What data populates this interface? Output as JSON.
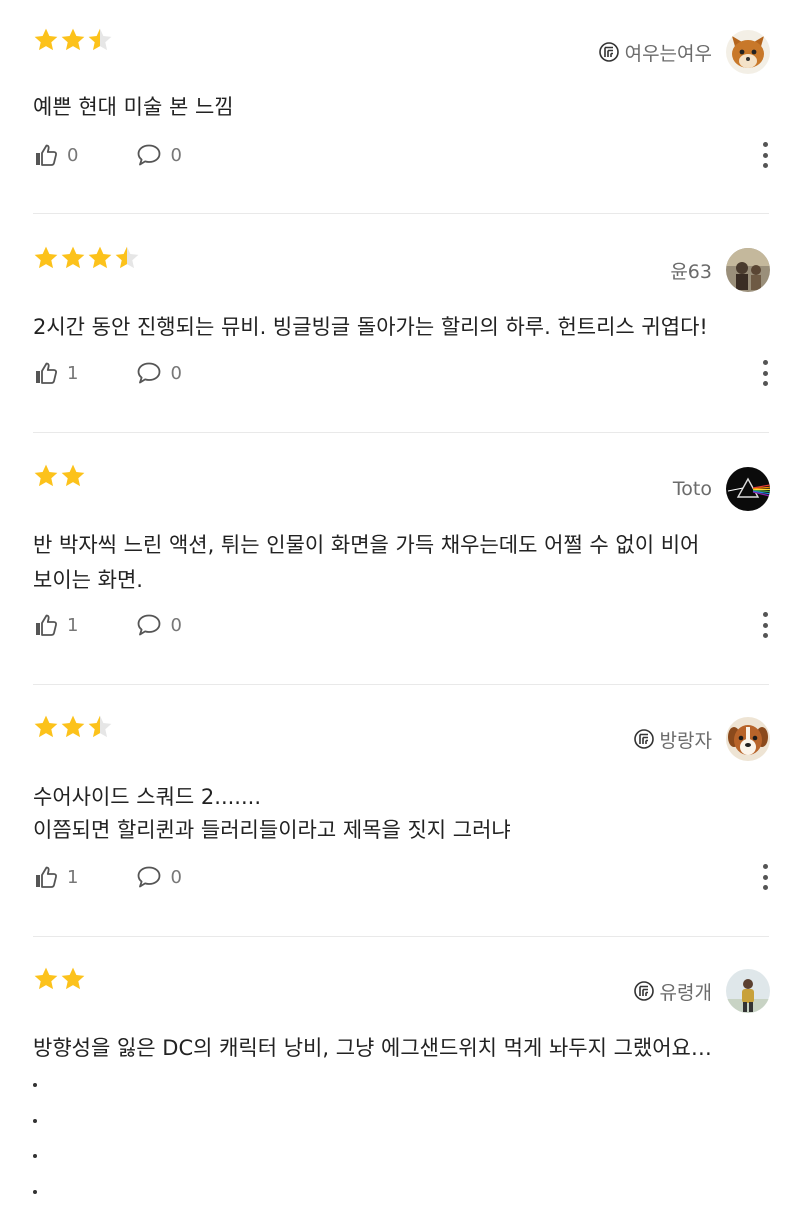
{
  "reviews": [
    {
      "rating": 2.5,
      "author": "여우는여우",
      "verified": true,
      "avatar": "fox-avatar",
      "lines": [
        "예쁜 현대 미술 본 느낌"
      ],
      "likes": "0",
      "comments": "0"
    },
    {
      "rating": 3.5,
      "author": "윤63",
      "verified": false,
      "avatar": "photo-avatar",
      "lines": [
        "2시간 동안 진행되는 뮤비. 빙글빙글 돌아가는 할리의 하루. 헌트리스 귀엽다!"
      ],
      "likes": "1",
      "comments": "0"
    },
    {
      "rating": 2,
      "author": "Toto",
      "verified": false,
      "avatar": "prism-avatar",
      "lines": [
        "반 박자씩 느린 액션, 튀는 인물이 화면을 가득 채우는데도 어쩔 수 없이 비어",
        "보이는 화면."
      ],
      "likes": "1",
      "comments": "0"
    },
    {
      "rating": 2.5,
      "author": "방랑자",
      "verified": true,
      "avatar": "dog-avatar",
      "lines": [
        "수어사이드 스쿼드 2.......",
        "이쯤되면 할리퀸과 들러리들이라고 제목을 짓지 그러냐"
      ],
      "likes": "1",
      "comments": "0"
    },
    {
      "rating": 2,
      "author": "유령개",
      "verified": true,
      "avatar": "person-avatar",
      "lines": [
        "방향성을 잃은 DC의 캐릭터 낭비, 그냥 에그샌드위치 먹게 놔두지 그랬어요…"
      ],
      "likes": "",
      "comments": ""
    }
  ],
  "colors": {
    "star_filled": "#FCC21B",
    "star_empty": "#E6E6E6",
    "text": "#222222",
    "muted": "#777777"
  },
  "icons": {
    "like": "thumbs-up-icon",
    "comment": "speech-bubble-icon",
    "more": "more-vertical-icon",
    "badge": "verified-badge-icon"
  }
}
